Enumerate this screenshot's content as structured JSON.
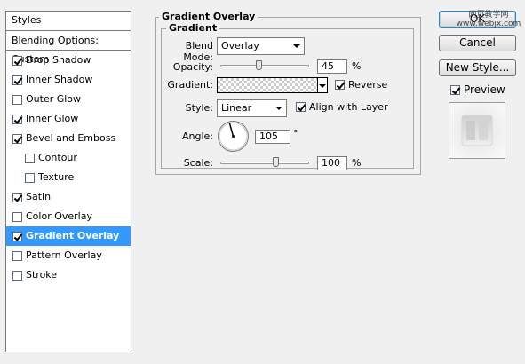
{
  "styles": {
    "header": "Styles",
    "blending_options": "Blending Options: Custom",
    "items": [
      {
        "label": "Drop Shadow",
        "checked": true
      },
      {
        "label": "Inner Shadow",
        "checked": true
      },
      {
        "label": "Outer Glow",
        "checked": false
      },
      {
        "label": "Inner Glow",
        "checked": true
      },
      {
        "label": "Bevel and Emboss",
        "checked": true
      },
      {
        "label": "Contour",
        "checked": false
      },
      {
        "label": "Texture",
        "checked": false
      },
      {
        "label": "Satin",
        "checked": true
      },
      {
        "label": "Color Overlay",
        "checked": false
      },
      {
        "label": "Gradient Overlay",
        "checked": true,
        "selected": true
      },
      {
        "label": "Pattern Overlay",
        "checked": false
      },
      {
        "label": "Stroke",
        "checked": false
      }
    ]
  },
  "section": {
    "title": "Gradient Overlay",
    "subtitle": "Gradient"
  },
  "controls": {
    "blend_mode_label": "Blend Mode:",
    "blend_mode_value": "Overlay",
    "opacity_label": "Opacity:",
    "opacity_value": "45",
    "opacity_unit": "%",
    "gradient_label": "Gradient:",
    "reverse_label": "Reverse",
    "reverse_checked": true,
    "style_label": "Style:",
    "style_value": "Linear",
    "align_label": "Align with Layer",
    "align_checked": true,
    "angle_label": "Angle:",
    "angle_value": "105",
    "angle_unit": "°",
    "scale_label": "Scale:",
    "scale_value": "100",
    "scale_unit": "%"
  },
  "buttons": {
    "ok": "OK",
    "cancel": "Cancel",
    "new_style": "New Style..."
  },
  "preview": {
    "label": "Preview",
    "checked": true
  },
  "watermark": "网页教学网 www.webjx.com"
}
